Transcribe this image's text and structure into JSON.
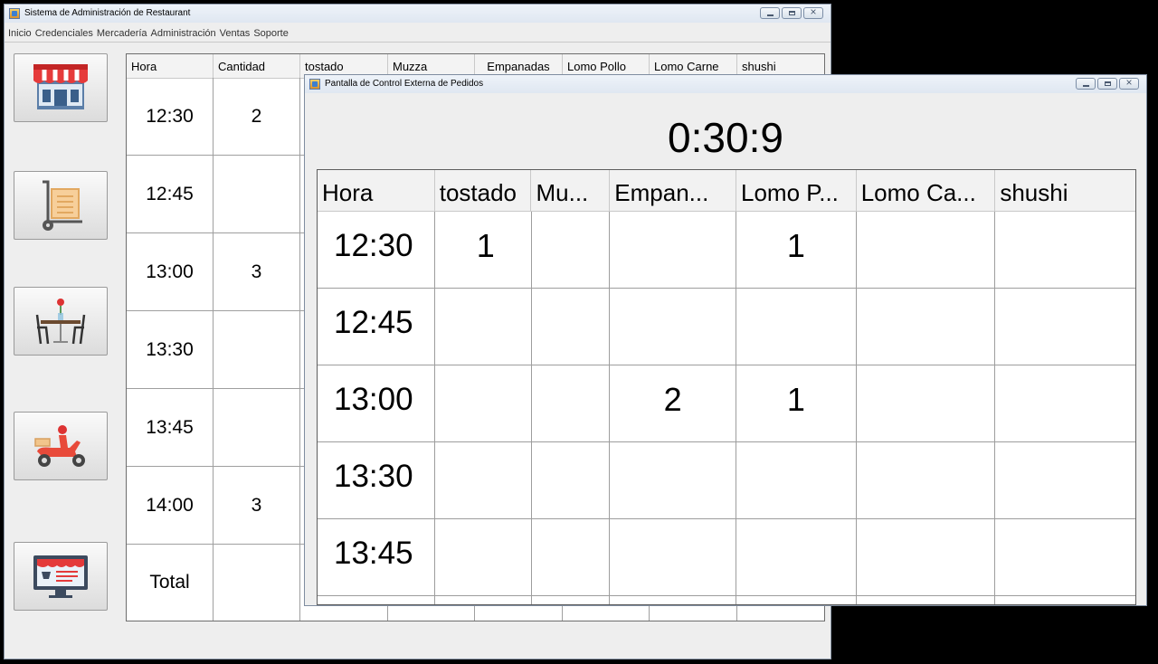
{
  "main_window": {
    "title": "Sistema de Administración de Restaurant",
    "menu": [
      "Inicio",
      "Credenciales",
      "Mercadería",
      "Administración",
      "Ventas",
      "Soporte"
    ],
    "sidebar": [
      {
        "icon": "store-icon"
      },
      {
        "icon": "cart-icon"
      },
      {
        "icon": "dining-table-icon"
      },
      {
        "icon": "delivery-scooter-icon"
      },
      {
        "icon": "online-shop-icon"
      }
    ],
    "table": {
      "columns": [
        "Hora",
        "Cantidad",
        "tostado",
        "Muzza",
        "Empanadas",
        "Lomo Pollo",
        "Lomo Carne",
        "shushi"
      ],
      "rows": [
        [
          "12:30",
          "2"
        ],
        [
          "12:45",
          ""
        ],
        [
          "13:00",
          "3"
        ],
        [
          "13:30",
          ""
        ],
        [
          "13:45",
          ""
        ],
        [
          "14:00",
          "3"
        ],
        [
          "Total",
          ""
        ]
      ]
    }
  },
  "second_window": {
    "title": "Pantalla de Control Externa de Pedidos",
    "timer": "0:30:9",
    "table": {
      "columns": [
        "Hora",
        "tostado",
        "Mu...",
        "Empan...",
        "Lomo P...",
        "Lomo Ca...",
        "shushi"
      ],
      "rows": [
        [
          "12:30",
          "1",
          "",
          "",
          "1",
          "",
          ""
        ],
        [
          "12:45",
          "",
          "",
          "",
          "",
          "",
          ""
        ],
        [
          "13:00",
          "",
          "",
          "2",
          "1",
          "",
          ""
        ],
        [
          "13:30",
          "",
          "",
          "",
          "",
          "",
          ""
        ],
        [
          "13:45",
          "",
          "",
          "",
          "",
          "",
          ""
        ],
        [
          "",
          "",
          "",
          "",
          "",
          "",
          ""
        ]
      ]
    }
  }
}
